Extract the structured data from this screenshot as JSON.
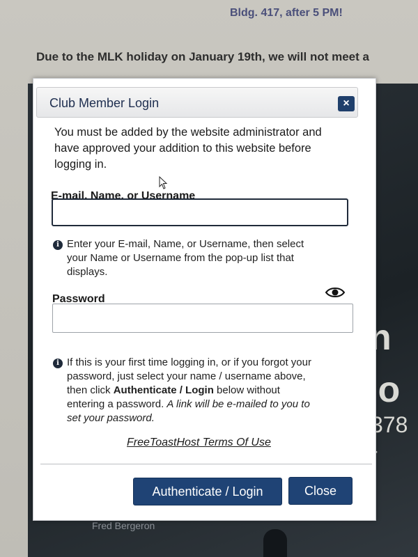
{
  "background": {
    "top_line": "Bldg. 417, after 5 PM!",
    "notice": "Due to the MLK holiday on January 19th, we will not meet a",
    "partial_n": "n",
    "partial_jo": "jo",
    "partial_number": "378 -",
    "caption": "Fred Bergeron"
  },
  "modal": {
    "title": "Club Member Login",
    "close_icon_glyph": "×",
    "intro": "You must be added by the website administrator and have approved your addition to this website before logging in.",
    "username": {
      "label": "E-mail, Name, or Username",
      "value": "",
      "placeholder": ""
    },
    "username_help": {
      "line1": "Enter your E-mail, Name, or Username, then select",
      "line2": "your Name or Username from the pop-up list that",
      "line3": "displays."
    },
    "password": {
      "label": "Password",
      "value": "",
      "placeholder": ""
    },
    "password_help": {
      "line1": "If this is your first time logging in, or if you forgot your",
      "line2": "password, just select your name / username above,",
      "line3_prefix": "then click ",
      "line3_bold": "Authenticate / Login",
      "line3_suffix": " below without",
      "line4_normal": "entering a password. ",
      "line4_italic": "A link will be e-mailed to you to",
      "line5_italic": "set your password."
    },
    "terms_link": "FreeToastHost Terms Of Use",
    "buttons": {
      "authenticate": "Authenticate / Login",
      "close": "Close"
    }
  },
  "colors": {
    "primary_button": "#1f4375",
    "title_text": "#1e2e4f"
  },
  "icons": [
    "close-icon",
    "info-icon",
    "eye-icon",
    "mouse-cursor-icon"
  ]
}
